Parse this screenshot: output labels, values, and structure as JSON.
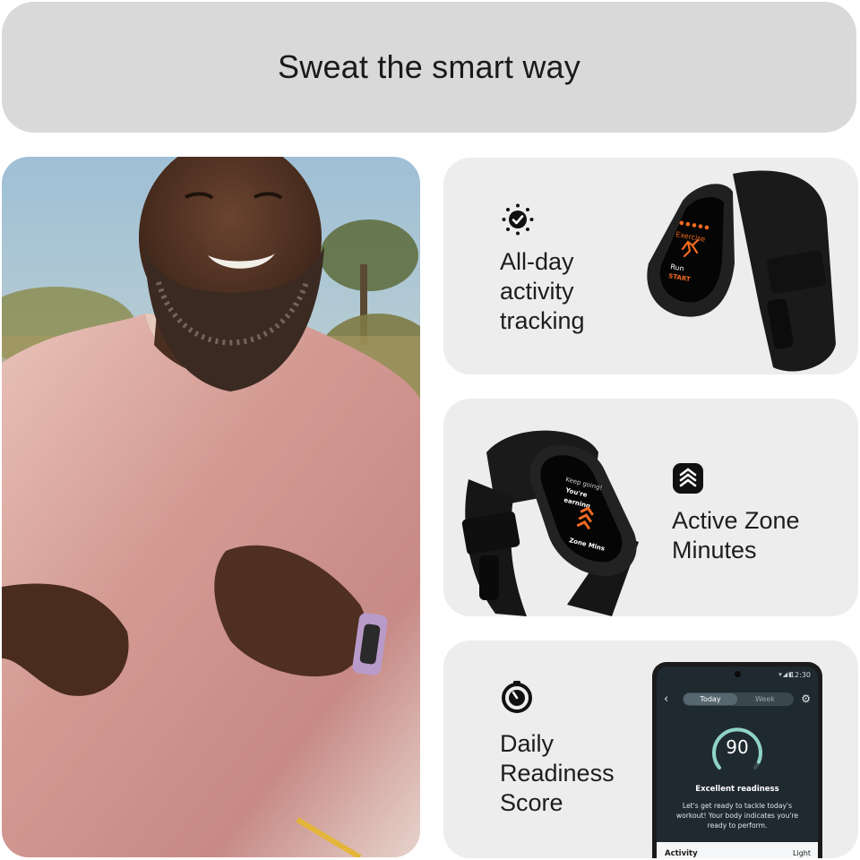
{
  "banner": {
    "title": "Sweat the smart way"
  },
  "photo": {
    "subject": "bearded man jogging outdoors wearing pink t-shirt and lavender fitness band"
  },
  "features": [
    {
      "label": "All-day\nactivity\ntracking",
      "icon": "sun-checkmark-icon",
      "device_screen": {
        "title": "Exercise",
        "line1": "Run",
        "line2": "START"
      }
    },
    {
      "label": "Active Zone\nMinutes",
      "icon": "chevrons-up-icon",
      "device_screen": {
        "line1": "Keep going!",
        "line2": "You're",
        "line3": "earning",
        "line4": "Zone Mins"
      }
    },
    {
      "label": "Daily\nReadiness\nScore",
      "icon": "gauge-icon",
      "phone": {
        "status_time": "12:30",
        "tab_today": "Today",
        "tab_week": "Week",
        "score": "90",
        "headline": "Excellent readiness",
        "description": "Let's get ready to tackle today's workout! Your body indicates you're ready to perform.",
        "activity_label": "Activity",
        "activity_value": "Light"
      }
    }
  ],
  "colors": {
    "banner_bg": "#d9d9d9",
    "card_bg": "#ededed",
    "accent_orange": "#f26a21",
    "gauge_teal": "#8fd3c8",
    "phone_bg": "#1f2a30"
  }
}
